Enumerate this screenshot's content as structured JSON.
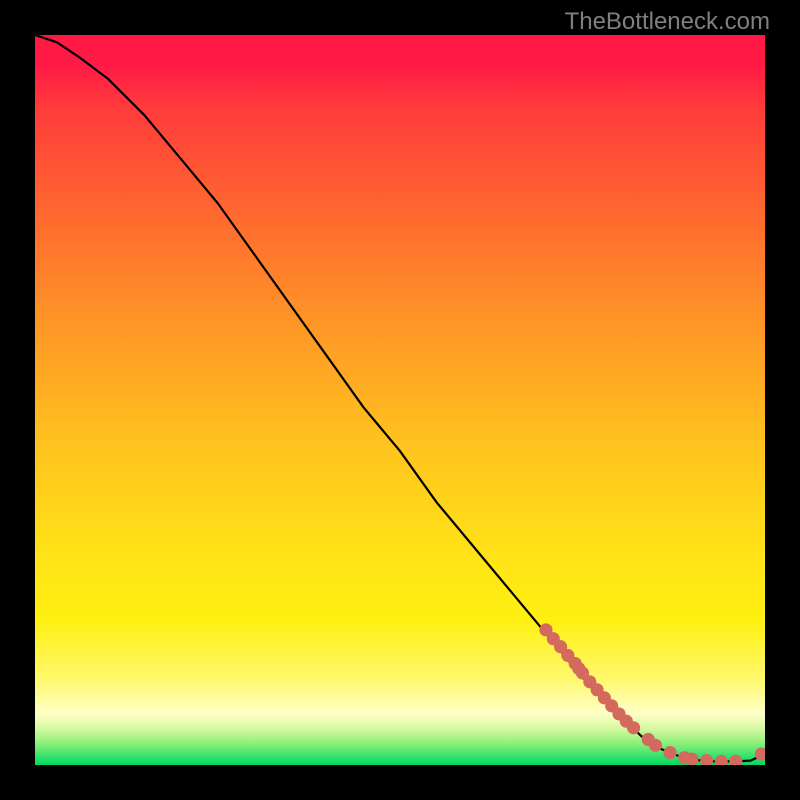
{
  "attribution": "TheBottleneck.com",
  "chart_data": {
    "type": "line",
    "title": "",
    "xlabel": "",
    "ylabel": "",
    "xlim": [
      0,
      100
    ],
    "ylim": [
      0,
      100
    ],
    "grid": false,
    "line": {
      "x": [
        0,
        3,
        6,
        10,
        15,
        20,
        25,
        30,
        35,
        40,
        45,
        50,
        55,
        60,
        65,
        70,
        75,
        80,
        83,
        85,
        88,
        90,
        92,
        94,
        96,
        98,
        100
      ],
      "y": [
        100,
        99,
        97,
        94,
        89,
        83,
        77,
        70,
        63,
        56,
        49,
        43,
        36,
        30,
        24,
        18,
        12,
        7,
        4,
        2.5,
        1.3,
        0.8,
        0.5,
        0.5,
        0.5,
        0.6,
        1.5
      ],
      "color": "#000000"
    },
    "points": {
      "x": [
        70,
        71,
        72,
        73,
        74,
        74.5,
        75,
        76,
        77,
        78,
        79,
        80,
        81,
        82,
        84,
        85,
        87,
        89,
        90,
        92,
        94,
        96,
        99.5
      ],
      "y": [
        18.5,
        17.3,
        16.2,
        15.0,
        13.9,
        13.2,
        12.6,
        11.4,
        10.3,
        9.2,
        8.1,
        7.0,
        6.0,
        5.1,
        3.5,
        2.7,
        1.7,
        1.0,
        0.8,
        0.6,
        0.5,
        0.5,
        1.5
      ],
      "color": "#d46a5e",
      "radius_pct": 0.9
    }
  },
  "gradient_stops": {
    "top": "#ff1a46",
    "mid_orange": "#ff9726",
    "yellow": "#fff010",
    "green": "#00d862"
  }
}
